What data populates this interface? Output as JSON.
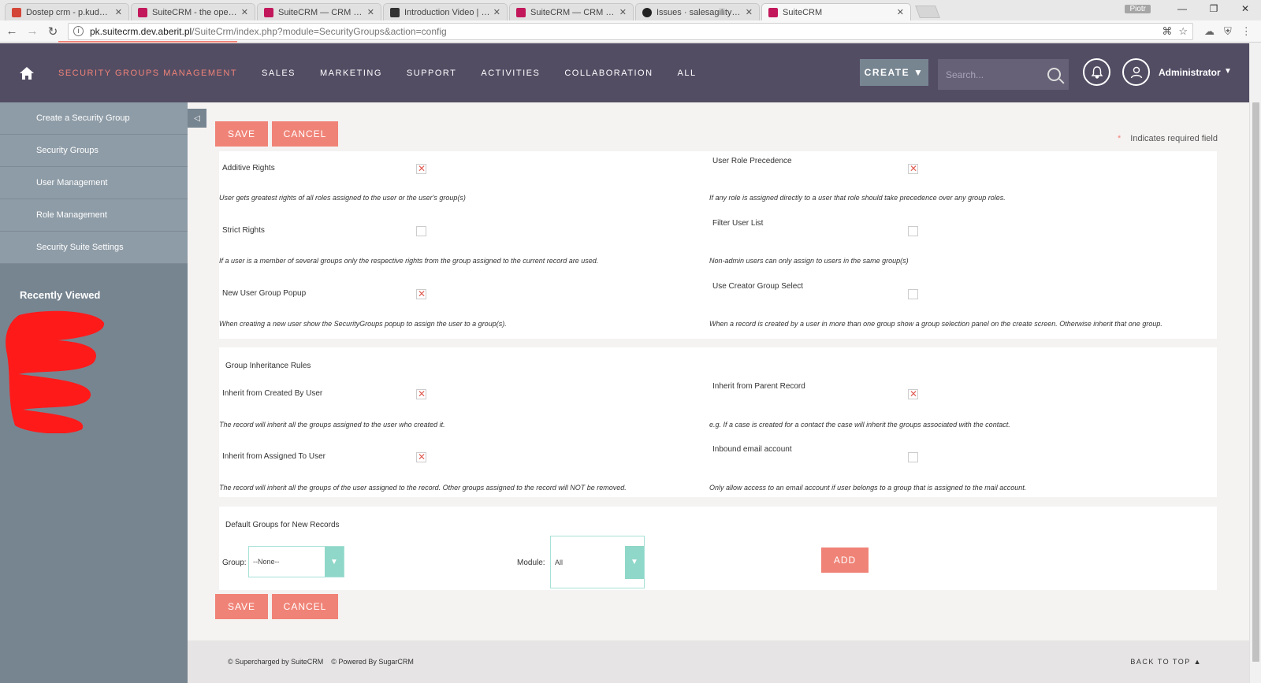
{
  "browser": {
    "tabs": [
      {
        "title": "Dostep crm - p.kudyba@",
        "favicon_color": "#d44638"
      },
      {
        "title": "SuiteCRM - the open sou",
        "favicon_color": "#c2185b"
      },
      {
        "title": "SuiteCRM — CRM for the",
        "favicon_color": "#c2185b"
      },
      {
        "title": "Introduction Video | Secu",
        "favicon_color": "#333333"
      },
      {
        "title": "SuiteCRM — CRM for the",
        "favicon_color": "#c2185b"
      },
      {
        "title": "Issues · salesagility/Suite",
        "favicon_color": "#222222"
      },
      {
        "title": "SuiteCRM",
        "favicon_color": "#c2185b"
      }
    ],
    "profile": "Piotr",
    "url_host": "pk.suitecrm.dev.aberit.pl",
    "url_path": "/SuiteCrm/index.php?module=SecurityGroups&action=config"
  },
  "topnav": {
    "items": [
      "SECURITY GROUPS MANAGEMENT",
      "SALES",
      "MARKETING",
      "SUPPORT",
      "ACTIVITIES",
      "COLLABORATION",
      "ALL"
    ],
    "create_label": "CREATE",
    "search_placeholder": "Search...",
    "user_name": "Administrator"
  },
  "sidebar": {
    "items": [
      "Create a Security Group",
      "Security Groups",
      "User Management",
      "Role Management",
      "Security Suite Settings"
    ],
    "recent_title": "Recently Viewed"
  },
  "form": {
    "save_label": "SAVE",
    "cancel_label": "CANCEL",
    "required_note": "Indicates required field",
    "required_star": "*",
    "settings": [
      {
        "label": "Additive Rights",
        "checked": true,
        "desc": "User gets greatest rights of all roles assigned to the user or the user's group(s)"
      },
      {
        "label": "User Role Precedence",
        "checked": true,
        "desc": "If any role is assigned directly to a user that role should take precedence over any group roles."
      },
      {
        "label": "Strict Rights",
        "checked": false,
        "desc": "If a user is a member of several groups only the respective rights from the group assigned to the current record are used."
      },
      {
        "label": "Filter User List",
        "checked": false,
        "desc": "Non-admin users can only assign to users in the same group(s)"
      },
      {
        "label": "New User Group Popup",
        "checked": true,
        "desc": "When creating a new user show the SecurityGroups popup to assign the user to a group(s)."
      },
      {
        "label": "Use Creator Group Select",
        "checked": false,
        "desc": "When a record is created by a user in more than one group show a group selection panel on the create screen. Otherwise inherit that one group."
      }
    ],
    "inheritance_title": "Group Inheritance Rules",
    "inheritance": [
      {
        "label": "Inherit from Created By User",
        "checked": true,
        "desc": "The record will inherit all the groups assigned to the user who created it."
      },
      {
        "label": "Inherit from Parent Record",
        "checked": true,
        "desc": "e.g. If a case is created for a contact the case will inherit the groups associated with the contact."
      },
      {
        "label": "Inherit from Assigned To User",
        "checked": true,
        "desc": "The record will inherit all the groups of the user assigned to the record. Other groups assigned to the record will NOT be removed."
      },
      {
        "label": "Inbound email account",
        "checked": false,
        "desc": "Only allow access to an email account if user belongs to a group that is assigned to the mail account."
      }
    ],
    "defaults_title": "Default Groups for New Records",
    "group_label": "Group:",
    "group_value": "--None--",
    "module_label": "Module:",
    "module_value": "All",
    "add_label": "ADD"
  },
  "footer": {
    "supercharged": "© Supercharged by SuiteCRM",
    "powered": "© Powered By SugarCRM",
    "back_to_top": "BACK TO TOP ▲"
  }
}
